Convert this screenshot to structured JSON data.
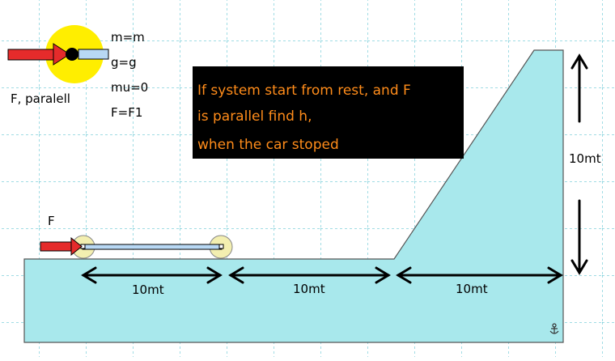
{
  "params": {
    "mass": "m=m",
    "gravity": "g=g",
    "friction": "mu=0",
    "force": "F=F1"
  },
  "legend_caption": "F, paralell",
  "force_label": "F",
  "problem_lines": [
    "If system start from rest, and F",
    "is parallel  find h,",
    " when the car stoped"
  ],
  "dimensions": {
    "segment_1": "10mt",
    "segment_2": "10mt",
    "segment_3": "10mt",
    "height": "10mt"
  },
  "colors": {
    "background": "#ffffff",
    "grid": "#40b8c8",
    "ground": "#a8e8ec",
    "note_bg": "#000000",
    "note_text": "#ff8c1a",
    "arrow": "#e52b2b",
    "wheel": "#f3efb0",
    "body": "#b8d8f4",
    "legend_circle": "#ffee00"
  },
  "icons": [
    "anchor-icon"
  ]
}
